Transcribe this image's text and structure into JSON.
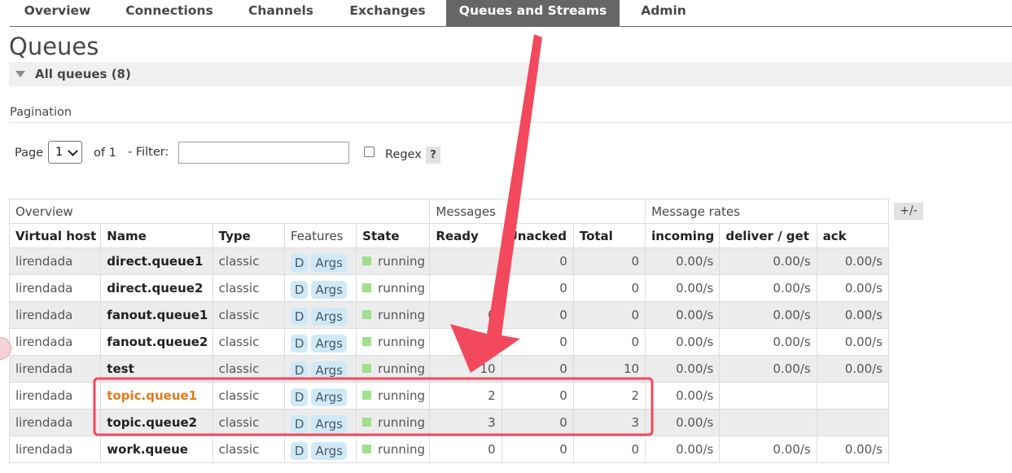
{
  "nav": {
    "tabs": [
      "Overview",
      "Connections",
      "Channels",
      "Exchanges",
      "Queues and Streams",
      "Admin"
    ],
    "active": "Queues and Streams"
  },
  "page": {
    "title": "Queues",
    "section_label": "All queues (8)"
  },
  "pagination": {
    "label": "Pagination",
    "page_label": "Page",
    "page_value": "1",
    "of_label": "of 1",
    "filter_label": "- Filter:",
    "filter_value": "",
    "regex_label": "Regex",
    "regex_checked": false,
    "help_label": "?"
  },
  "table": {
    "group_headers": {
      "overview": "Overview",
      "messages": "Messages",
      "rates": "Message rates"
    },
    "toggle_columns_label": "+/-",
    "columns": [
      "Virtual host",
      "Name",
      "Type",
      "Features",
      "State",
      "Ready",
      "Unacked",
      "Total",
      "incoming",
      "deliver / get",
      "ack"
    ],
    "rows": [
      {
        "vhost": "lirendada",
        "name": "direct.queue1",
        "type": "classic",
        "f1": "D",
        "f2": "Args",
        "state": "running",
        "ready": "",
        "unacked": "0",
        "total": "0",
        "incoming": "0.00/s",
        "deliver": "0.00/s",
        "ack": "0.00/s"
      },
      {
        "vhost": "lirendada",
        "name": "direct.queue2",
        "type": "classic",
        "f1": "D",
        "f2": "Args",
        "state": "running",
        "ready": "",
        "unacked": "0",
        "total": "0",
        "incoming": "0.00/s",
        "deliver": "0.00/s",
        "ack": "0.00/s"
      },
      {
        "vhost": "lirendada",
        "name": "fanout.queue1",
        "type": "classic",
        "f1": "D",
        "f2": "Args",
        "state": "running",
        "ready": "0",
        "unacked": "0",
        "total": "0",
        "incoming": "0.00/s",
        "deliver": "0.00/s",
        "ack": "0.00/s"
      },
      {
        "vhost": "lirendada",
        "name": "fanout.queue2",
        "type": "classic",
        "f1": "D",
        "f2": "Args",
        "state": "running",
        "ready": "",
        "unacked": "0",
        "total": "0",
        "incoming": "0.00/s",
        "deliver": "0.00/s",
        "ack": "0.00/s"
      },
      {
        "vhost": "lirendada",
        "name": "test",
        "type": "classic",
        "f1": "D",
        "f2": "Args",
        "state": "running",
        "ready": "10",
        "unacked": "0",
        "total": "10",
        "incoming": "0.00/s",
        "deliver": "0.00/s",
        "ack": "0.00/s"
      },
      {
        "vhost": "lirendada",
        "name": "topic.queue1",
        "type": "classic",
        "f1": "D",
        "f2": "Args",
        "state": "running",
        "ready": "2",
        "unacked": "0",
        "total": "2",
        "incoming": "0.00/s",
        "deliver": "",
        "ack": ""
      },
      {
        "vhost": "lirendada",
        "name": "topic.queue2",
        "type": "classic",
        "f1": "D",
        "f2": "Args",
        "state": "running",
        "ready": "3",
        "unacked": "0",
        "total": "3",
        "incoming": "0.00/s",
        "deliver": "",
        "ack": ""
      },
      {
        "vhost": "lirendada",
        "name": "work.queue",
        "type": "classic",
        "f1": "D",
        "f2": "Args",
        "state": "running",
        "ready": "0",
        "unacked": "0",
        "total": "0",
        "incoming": "0.00/s",
        "deliver": "0.00/s",
        "ack": "0.00/s"
      }
    ]
  },
  "colors": {
    "nav_active_bg": "#666666",
    "link_orange": "#e07b1c",
    "running_dot": "#9fe08a",
    "feature_tag_bg": "#cfe9f7",
    "annotation_red": "#f2495c"
  }
}
